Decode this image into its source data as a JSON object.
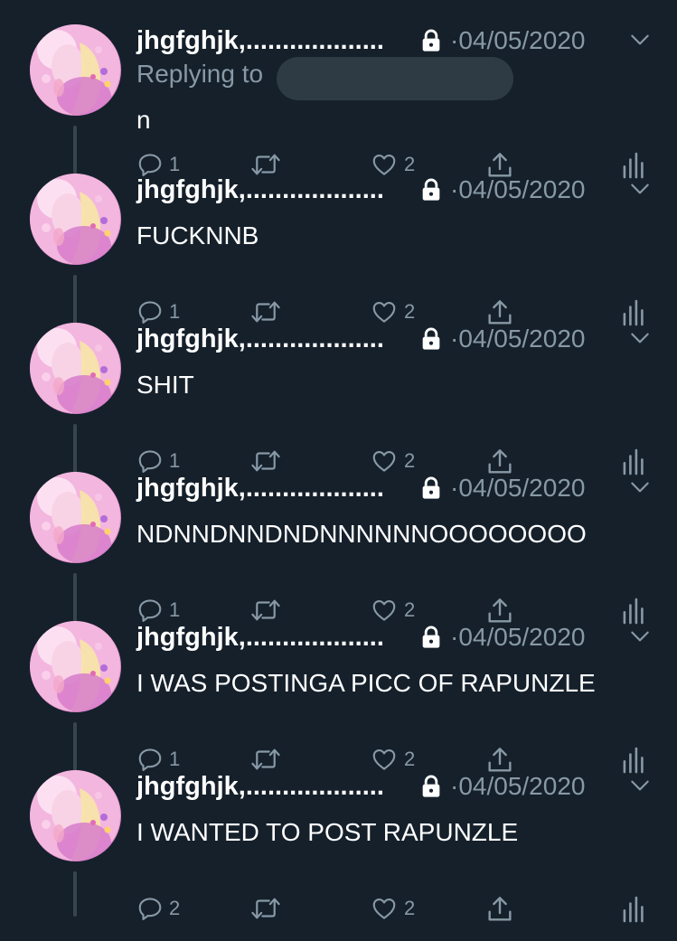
{
  "colors": {
    "background": "#15202b",
    "primary_text": "#ffffff",
    "secondary_text": "#8899a6",
    "thread_line": "#38444d",
    "redaction": "#2e3a44"
  },
  "icons": {
    "lock": "lock-icon",
    "menu": "chevron-down-icon",
    "reply": "reply-icon",
    "retweet": "retweet-icon",
    "like": "heart-icon",
    "share": "share-icon",
    "analytics": "analytics-icon"
  },
  "tweets": [
    {
      "display_name": "jhgfghjk,...................",
      "separator": "·",
      "date": "04/05/2020",
      "replying_to_label": "Replying to",
      "text": "n",
      "reply_count": "1",
      "like_count": "2"
    },
    {
      "display_name": "jhgfghjk,...................",
      "separator": "·",
      "date": "04/05/2020",
      "text": "FUCKNNB",
      "reply_count": "1",
      "like_count": "2"
    },
    {
      "display_name": "jhgfghjk,...................",
      "separator": "·",
      "date": "04/05/2020",
      "text": "SHIT",
      "reply_count": "1",
      "like_count": "2"
    },
    {
      "display_name": "jhgfghjk,...................",
      "separator": "·",
      "date": "04/05/2020",
      "text": "NDNNDNNDNDNNNNNNOOOOOOOO",
      "reply_count": "1",
      "like_count": "2"
    },
    {
      "display_name": "jhgfghjk,...................",
      "separator": "·",
      "date": "04/05/2020",
      "text": "I WAS POSTINGA  PICC OF RAPUNZLE",
      "reply_count": "1",
      "like_count": "2"
    },
    {
      "display_name": "jhgfghjk,...................",
      "separator": "·",
      "date": "04/05/2020",
      "text": "I WANTED TO POST RAPUNZLE",
      "reply_count": "2",
      "like_count": "2"
    }
  ]
}
